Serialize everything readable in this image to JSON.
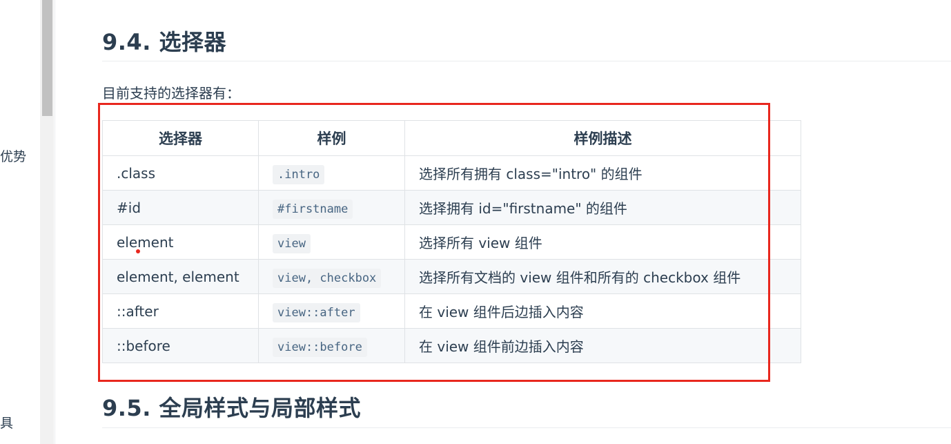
{
  "sidebar": {
    "partial_text_1": "优势",
    "partial_text_2": "具"
  },
  "sections": [
    {
      "title": "9.4. 选择器"
    },
    {
      "title": "9.5. 全局样式与局部样式"
    }
  ],
  "intro": "目前支持的选择器有：",
  "table": {
    "headers": [
      "选择器",
      "样例",
      "样例描述"
    ],
    "rows": [
      {
        "selector": ".class",
        "example": ".intro",
        "description": "选择所有拥有 class=\"intro\" 的组件"
      },
      {
        "selector": "#id",
        "example": "#firstname",
        "description": "选择拥有 id=\"firstname\" 的组件"
      },
      {
        "selector": "element",
        "example": "view",
        "description": "选择所有 view 组件"
      },
      {
        "selector": "element, element",
        "example": "view, checkbox",
        "description": "选择所有文档的 view 组件和所有的 checkbox 组件"
      },
      {
        "selector": "::after",
        "example": "view::after",
        "description": "在 view 组件后边插入内容"
      },
      {
        "selector": "::before",
        "example": "view::before",
        "description": "在 view 组件前边插入内容"
      }
    ]
  },
  "colors": {
    "highlight_box": "#e8271e",
    "text": "#2c3e50",
    "code_bg": "#f0f2f4",
    "border": "#dfe2e5"
  }
}
